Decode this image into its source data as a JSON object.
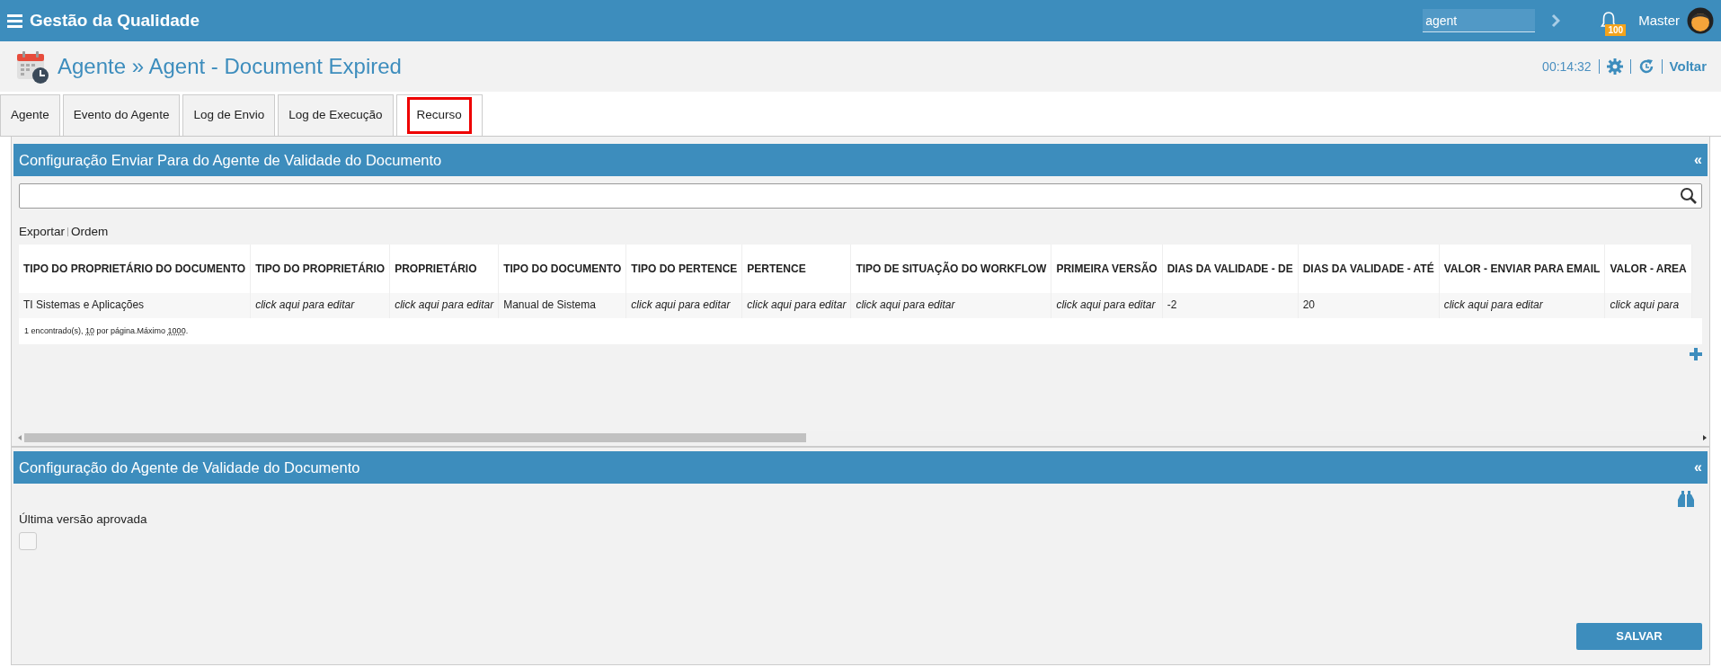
{
  "app_bar": {
    "title": "Gestão da Qualidade",
    "search": {
      "value": "agent"
    },
    "notification_badge": "100",
    "user_name": "Master"
  },
  "page_header": {
    "title": "Agente » Agent - Document Expired",
    "timer": "00:14:32",
    "back_link": "Voltar"
  },
  "tabs": [
    {
      "label": "Agente",
      "selected": false
    },
    {
      "label": "Evento do Agente",
      "selected": false
    },
    {
      "label": "Log de Envio",
      "selected": false
    },
    {
      "label": "Log de Execução",
      "selected": false
    },
    {
      "label": "Recurso",
      "selected": true
    }
  ],
  "recipients_panel": {
    "title": "Configuração Enviar Para do Agente de Validade do Documento",
    "collapse": "«",
    "toolbar_links": [
      "Exportar",
      "Ordem"
    ],
    "table": {
      "columns": [
        "TIPO DO PROPRIETÁRIO DO DOCUMENTO",
        "TIPO DO PROPRIETÁRIO",
        "PROPRIETÁRIO",
        "TIPO DO DOCUMENTO",
        "TIPO DO PERTENCE",
        "PERTENCE",
        "TIPO DE SITUAÇÃO DO WORKFLOW",
        "PRIMEIRA VERSÃO",
        "DIAS DA VALIDADE - DE",
        "DIAS DA VALIDADE - ATÉ",
        "VALOR - ENVIAR PARA EMAIL",
        "VALOR - AREA"
      ],
      "rows": [
        [
          {
            "text": "TI Sistemas e Aplicações",
            "kind": "value"
          },
          {
            "text": "click aqui para editar",
            "kind": "prompt"
          },
          {
            "text": "click aqui para editar",
            "kind": "prompt"
          },
          {
            "text": "Manual de Sistema",
            "kind": "value"
          },
          {
            "text": "click aqui para editar",
            "kind": "prompt"
          },
          {
            "text": "click aqui para editar",
            "kind": "prompt"
          },
          {
            "text": "click aqui para editar",
            "kind": "prompt"
          },
          {
            "text": "click aqui para editar",
            "kind": "prompt"
          },
          {
            "text": "-2",
            "kind": "value"
          },
          {
            "text": "20",
            "kind": "value"
          },
          {
            "text": "click aqui para editar",
            "kind": "prompt"
          },
          {
            "text": "click aqui para",
            "kind": "prompt"
          }
        ]
      ]
    },
    "pager": [
      {
        "text": "1 encontrado(s), ",
        "kind": "text"
      },
      {
        "text": "10",
        "kind": "link"
      },
      {
        "text": " por página.Máximo ",
        "kind": "text"
      },
      {
        "text": "1000",
        "kind": "link"
      },
      {
        "text": ".",
        "kind": "text"
      }
    ]
  },
  "config_panel": {
    "title": "Configuração do Agente de Validade do Documento",
    "collapse": "«",
    "fields": [
      {
        "label": "Última versão aprovada",
        "checked": false
      }
    ],
    "save_button": "SALVAR"
  }
}
